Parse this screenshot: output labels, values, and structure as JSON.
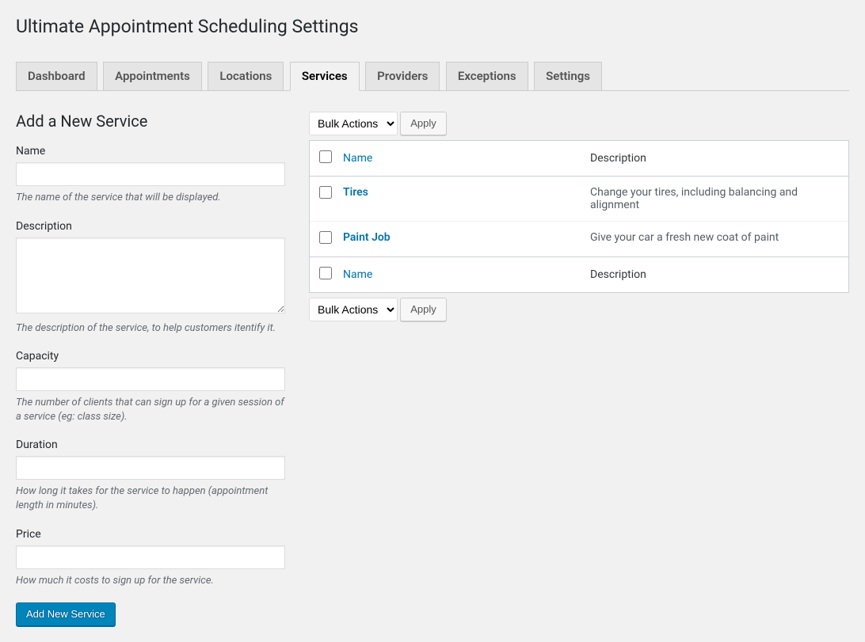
{
  "page": {
    "title": "Ultimate Appointment Scheduling Settings"
  },
  "tabs": [
    {
      "label": "Dashboard",
      "active": false
    },
    {
      "label": "Appointments",
      "active": false
    },
    {
      "label": "Locations",
      "active": false
    },
    {
      "label": "Services",
      "active": true
    },
    {
      "label": "Providers",
      "active": false
    },
    {
      "label": "Exceptions",
      "active": false
    },
    {
      "label": "Settings",
      "active": false
    }
  ],
  "form": {
    "heading": "Add a New Service",
    "fields": {
      "name": {
        "label": "Name",
        "hint": "The name of the service that will be displayed.",
        "value": ""
      },
      "description": {
        "label": "Description",
        "hint": "The description of the service, to help customers itentify it.",
        "value": ""
      },
      "capacity": {
        "label": "Capacity",
        "hint": "The number of clients that can sign up for a given session of a service (eg: class size).",
        "value": ""
      },
      "duration": {
        "label": "Duration",
        "hint": "How long it takes for the service to happen (appointment length in minutes).",
        "value": ""
      },
      "price": {
        "label": "Price",
        "hint": "How much it costs to sign up for the service.",
        "value": ""
      }
    },
    "submit_label": "Add New Service"
  },
  "bulk": {
    "select_label": "Bulk Actions",
    "apply_label": "Apply"
  },
  "table": {
    "columns": {
      "name": "Name",
      "description": "Description"
    },
    "rows": [
      {
        "name": "Tires",
        "description": "Change your tires, including balancing and alignment"
      },
      {
        "name": "Paint Job",
        "description": "Give your car a fresh new coat of paint"
      }
    ]
  }
}
